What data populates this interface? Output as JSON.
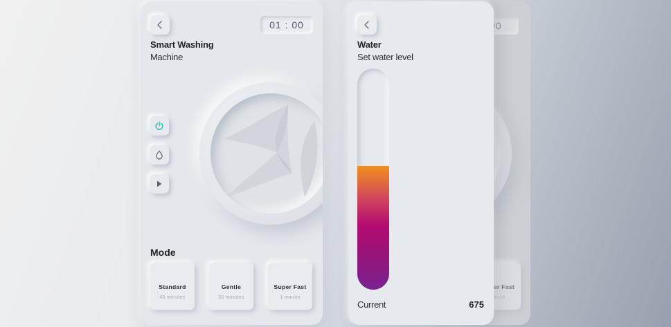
{
  "screen_main": {
    "timer": "01 : 00",
    "title": "Smart Washing",
    "subtitle": "Machine",
    "controls": [
      {
        "icon": "power-icon",
        "active": true
      },
      {
        "icon": "drop-icon",
        "active": false
      },
      {
        "icon": "play-icon",
        "active": false
      }
    ],
    "mode_heading": "Mode",
    "modes": [
      {
        "name": "Standard",
        "time": "45 minutes"
      },
      {
        "name": "Gentle",
        "time": "30 minutes"
      },
      {
        "name": "Super Fast",
        "time": "1 minute"
      }
    ]
  },
  "screen_water": {
    "title": "Water",
    "subtitle": "Set water level",
    "level_fraction": 0.56,
    "current_label": "Current",
    "current_value": "675"
  },
  "screen_background": {
    "timer_partial": ": 00",
    "mode_partial": "er Fast",
    "mode_time_partial": "inute"
  },
  "colors": {
    "accent_power": "#2ec4a0",
    "fill_top": "#f0901c",
    "fill_mid": "#b40b6f",
    "fill_bottom": "#7a2293"
  }
}
